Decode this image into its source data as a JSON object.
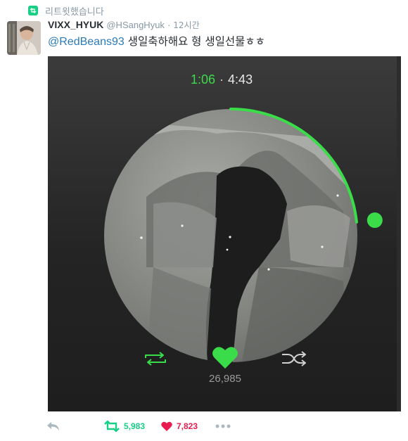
{
  "retweet_context": {
    "text": "리트윗했습니다"
  },
  "tweet": {
    "author_name": "VIXX_HYUK",
    "author_handle": "@HSangHyuk",
    "separator": "·",
    "time": "12시간",
    "mention": "@RedBeans93",
    "text": " 생일축하해요 형 생일선물ㅎㅎ"
  },
  "player": {
    "elapsed": "1:06",
    "separator": "·",
    "duration": "4:43",
    "progress_fraction": 0.233,
    "like_count": "26,985"
  },
  "actions": {
    "retweet_count": "5,983",
    "like_count": "7,823"
  },
  "colors": {
    "accent_green": "#3bdc4a",
    "retweet_green": "#19cf86",
    "like_red": "#e81c4f",
    "link_blue": "#2b7bb9",
    "muted_gray": "#8899a6"
  },
  "icons": [
    "retweet-badge-icon",
    "repeat-icon",
    "heart-icon",
    "shuffle-icon",
    "reply-icon",
    "retweet-icon",
    "like-icon",
    "more-icon"
  ]
}
